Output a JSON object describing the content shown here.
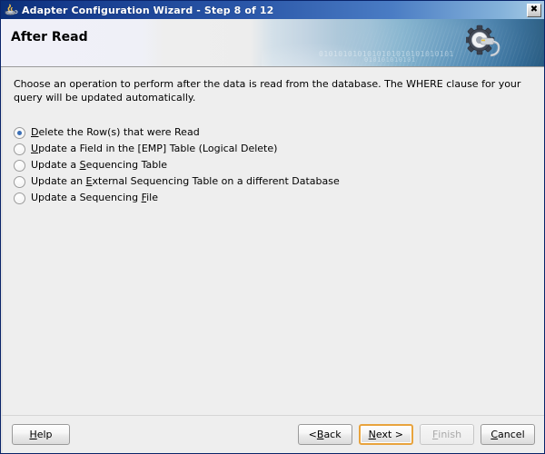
{
  "window": {
    "title": "Adapter Configuration Wizard - Step 8 of 12",
    "icon": "java-coffee-cup-icon",
    "close_label": "✖"
  },
  "header": {
    "title": "After Read",
    "banner_binary_top": "0101010101010101010101010101",
    "banner_binary_bottom": "010101010101",
    "graphic": "gear-with-cable-icon"
  },
  "content": {
    "instructions": "Choose an operation to perform after the data is read from the database.  The WHERE clause for your query will be updated automatically.",
    "options": [
      {
        "id": "delete-rows",
        "selected": true,
        "pre": "",
        "mnemonic": "D",
        "post": "elete the Row(s) that were Read"
      },
      {
        "id": "update-field-emp",
        "selected": false,
        "pre": "",
        "mnemonic": "U",
        "post": "pdate a Field in the [EMP] Table (Logical Delete)"
      },
      {
        "id": "update-sequencing-table",
        "selected": false,
        "pre": "Update a ",
        "mnemonic": "S",
        "post": "equencing Table"
      },
      {
        "id": "update-external-sequencing-table",
        "selected": false,
        "pre": "Update an ",
        "mnemonic": "E",
        "post": "xternal Sequencing Table on a different Database"
      },
      {
        "id": "update-sequencing-file",
        "selected": false,
        "pre": "Update a Sequencing ",
        "mnemonic": "F",
        "post": "ile"
      }
    ]
  },
  "buttons": {
    "help": {
      "pre": "",
      "mnemonic": "H",
      "post": "elp",
      "disabled": false,
      "focused": false
    },
    "back": {
      "pre": "< ",
      "mnemonic": "B",
      "post": "ack",
      "disabled": false,
      "focused": false
    },
    "next": {
      "pre": "",
      "mnemonic": "N",
      "post": "ext >",
      "disabled": false,
      "focused": true
    },
    "finish": {
      "pre": "",
      "mnemonic": "F",
      "post": "inish",
      "disabled": true,
      "focused": false
    },
    "cancel": {
      "pre": "",
      "mnemonic": "C",
      "post": "ancel",
      "disabled": false,
      "focused": false
    }
  },
  "colors": {
    "titlebar_start": "#0b2f78",
    "titlebar_end": "#a8cbe6",
    "banner_blue": "#25597f",
    "dialog_bg": "#eeeeee",
    "focus_ring": "#e8a33d",
    "radio_dot": "#3b6fb6"
  }
}
